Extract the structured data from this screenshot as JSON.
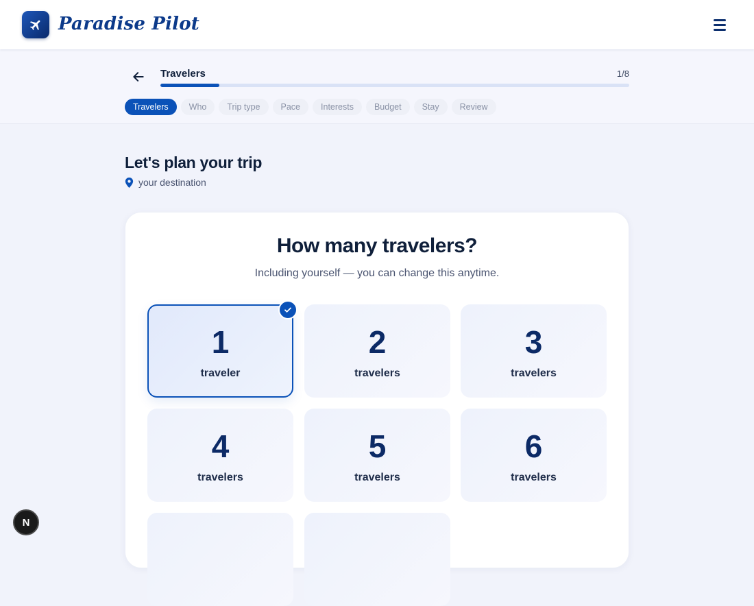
{
  "brand": {
    "name": "Paradise Pilot",
    "logo_icon": "airplane-icon"
  },
  "header": {
    "menu_icon": "hamburger-menu-icon"
  },
  "wizard": {
    "current_step_title": "Travelers",
    "step_counter": "1/8",
    "progress_fraction": 0.125,
    "steps": [
      "Travelers",
      "Who",
      "Trip type",
      "Pace",
      "Interests",
      "Budget",
      "Stay",
      "Review"
    ],
    "active_step_index": 0
  },
  "page": {
    "heading": "Let's plan your trip",
    "destination": "your destination"
  },
  "question": {
    "title": "How many travelers?",
    "subtitle": "Including yourself — you can change this anytime.",
    "options": [
      {
        "number": "1",
        "label": "traveler",
        "selected": true
      },
      {
        "number": "2",
        "label": "travelers",
        "selected": false
      },
      {
        "number": "3",
        "label": "travelers",
        "selected": false
      },
      {
        "number": "4",
        "label": "travelers",
        "selected": false
      },
      {
        "number": "5",
        "label": "travelers",
        "selected": false
      },
      {
        "number": "6",
        "label": "travelers",
        "selected": false
      },
      {
        "number": "",
        "label": "",
        "selected": false
      },
      {
        "number": "",
        "label": "",
        "selected": false
      }
    ]
  },
  "dev_badge": {
    "letter": "N"
  },
  "colors": {
    "accent": "#0b52b8",
    "brand_text": "#0c3a8a",
    "page_bg": "#f1f3fb"
  }
}
